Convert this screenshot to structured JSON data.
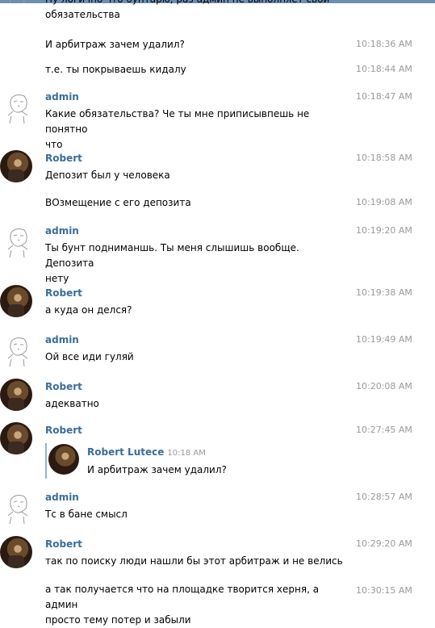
{
  "messages": [
    {
      "lines": [
        "Ну логично что бунтарю, раз админ не выполняет свои",
        "обязательства"
      ]
    },
    {
      "text": "И арбитраж зачем удалил?",
      "time": "10:18:36 AM"
    },
    {
      "text": "т.е. ты покрываешь кидалу",
      "time": "10:18:44 AM"
    },
    {
      "name": "admin",
      "time": "10:18:47 AM",
      "lines": [
        "Какие обязательства? Че ты мне приписывпешь не понятно",
        "что"
      ]
    },
    {
      "name": "Robert",
      "time": "10:18:58 AM",
      "text": "Депозит был у человека"
    },
    {
      "text": "ВОзмещение с его депозита",
      "time": "10:19:08 AM"
    },
    {
      "name": "admin",
      "time": "10:19:20 AM",
      "lines": [
        "Ты бунт подниманшь. Ты меня слышишь вообще. Депозита",
        "нету"
      ]
    },
    {
      "name": "Robert",
      "time": "10:19:38 AM",
      "text": "а куда он делся?"
    },
    {
      "name": "admin",
      "time": "10:19:49 AM",
      "text": "Ой все иди гуляй"
    },
    {
      "name": "Robert",
      "time": "10:20:08 AM",
      "text": "адекватно"
    },
    {
      "name": "Robert",
      "time": "10:27:45 AM",
      "forward": {
        "name": "Robert Lutece",
        "time": "10:18 AM",
        "text": "И арбитраж зачем удалил?"
      }
    },
    {
      "name": "admin",
      "time": "10:28:57 AM",
      "text": "Тс в бане смысл"
    },
    {
      "name": "Robert",
      "time": "10:29:20 AM",
      "text": "так по поиску люди нашли бы этот арбитраж и не велись"
    },
    {
      "time": "10:30:15 AM",
      "lines": [
        "а так получается что на площадке творится херня, а админ",
        "просто тему потер и забыли"
      ]
    }
  ]
}
